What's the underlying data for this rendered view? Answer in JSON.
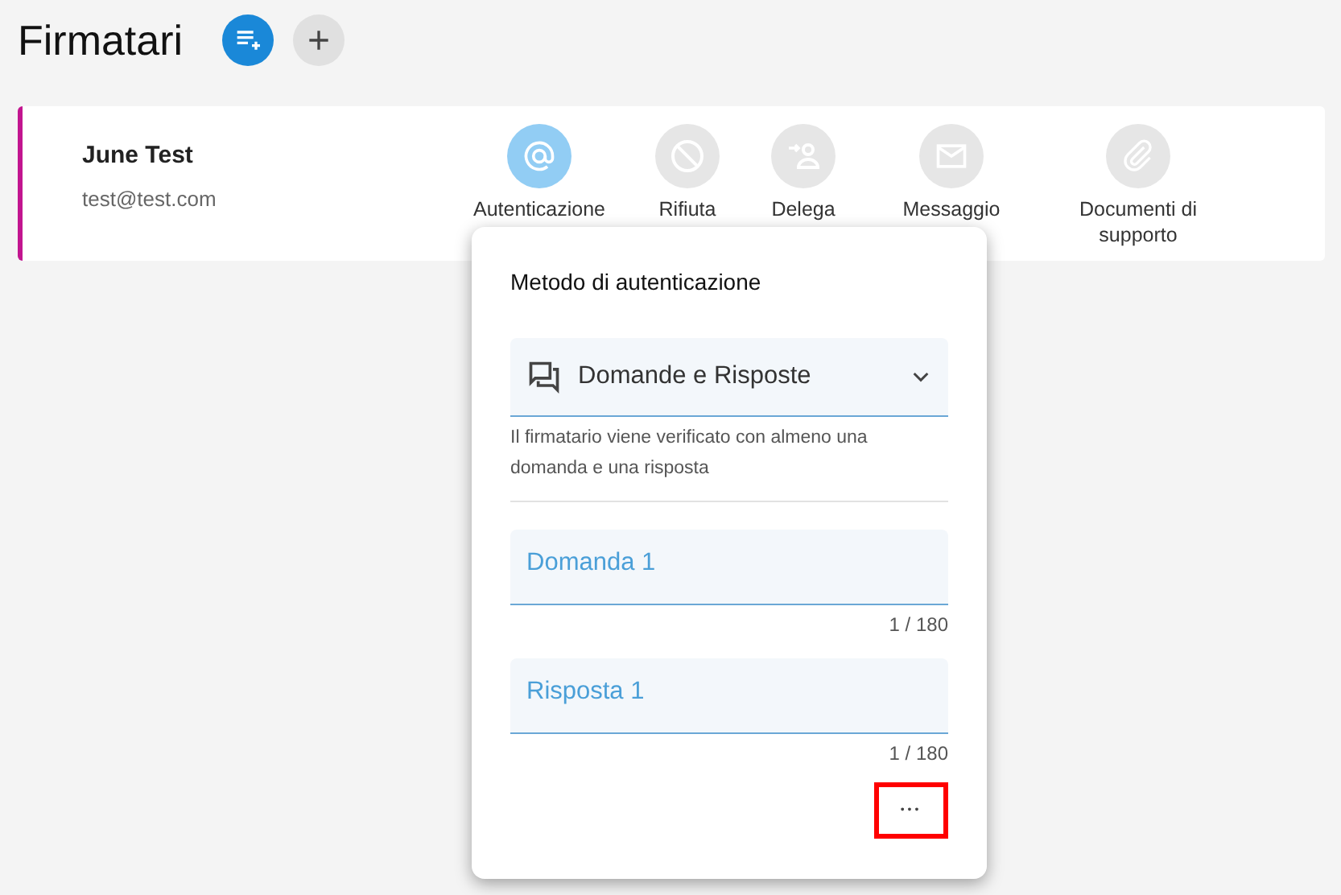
{
  "page_title": "Firmatari",
  "header_buttons": [
    {
      "kind": "add-list",
      "selected": true
    },
    {
      "kind": "add",
      "selected": false
    }
  ],
  "signer": {
    "name": "June Test",
    "email": "test@test.com",
    "color": "#c2158f"
  },
  "actions": [
    {
      "label": "Autenticazione",
      "kind": "at",
      "selected": true
    },
    {
      "label": "Rifiuta",
      "kind": "block",
      "selected": false
    },
    {
      "label": "Delega",
      "kind": "delegate",
      "selected": false
    },
    {
      "label": "Messaggio",
      "kind": "mail",
      "selected": false
    },
    {
      "label": "Documenti di supporto",
      "kind": "clip",
      "selected": false
    }
  ],
  "popup": {
    "title": "Metodo di autenticazione",
    "method": {
      "value": "Domande e Risposte",
      "hint": "Il firmatario viene verificato con almeno una domanda e una risposta"
    },
    "fields": [
      {
        "label": "Domanda 1",
        "counter": "1 / 180"
      },
      {
        "label": "Risposta 1",
        "counter": "1 / 180"
      }
    ],
    "more": {
      "label": "•••",
      "highlighted": true
    }
  }
}
